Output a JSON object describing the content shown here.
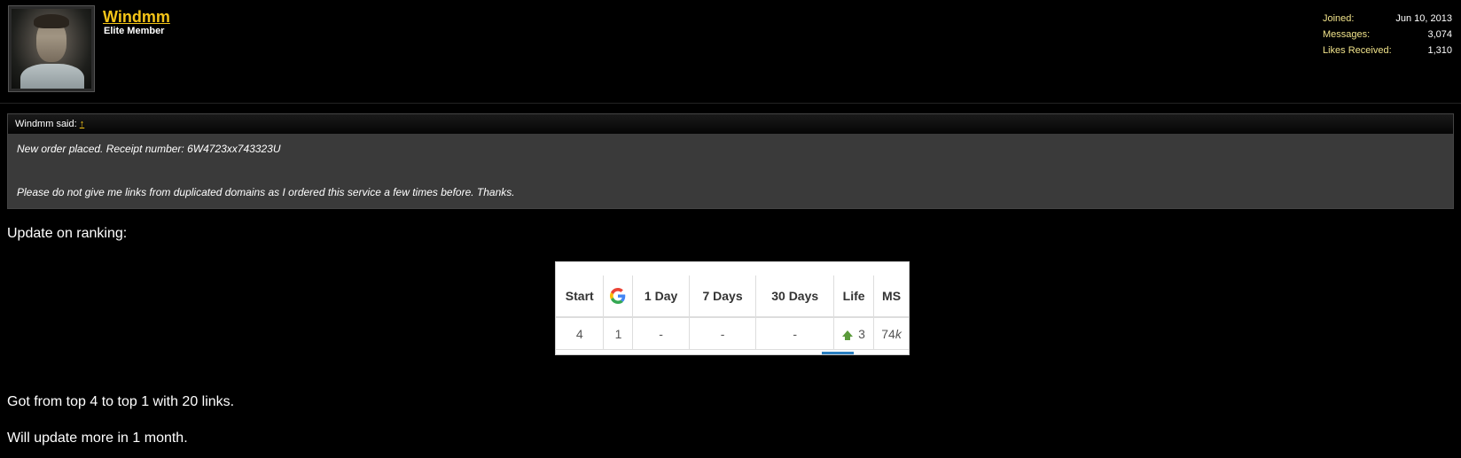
{
  "user": {
    "name": "Windmm",
    "title": "Elite Member"
  },
  "stats": {
    "joined_label": "Joined:",
    "joined_value": "Jun 10, 2013",
    "messages_label": "Messages:",
    "messages_value": "3,074",
    "likes_label": "Likes Received:",
    "likes_value": "1,310"
  },
  "quote": {
    "author": "Windmm said:",
    "arrow": "↑",
    "line1": "New order placed. Receipt number: 6W4723xx743323U",
    "line2": "Please do not give me links from duplicated domains as I ordered this service a few times before. Thanks."
  },
  "post": {
    "intro": "Update on ranking:",
    "line1": "Got from top 4 to top 1 with 20 links.",
    "line2": "Will update more in 1 month."
  },
  "ranking_table": {
    "headers": [
      "Start",
      "",
      "1 Day",
      "7 Days",
      "30 Days",
      "Life",
      "MS"
    ],
    "row": {
      "start": "4",
      "google": "1",
      "day1": "-",
      "day7": "-",
      "day30": "-",
      "life": "3",
      "ms_num": "74",
      "ms_unit": "k"
    }
  },
  "colors": {
    "accent": "#f5c518",
    "quote_bg": "#3a3a3a",
    "up_arrow": "#5a9a3a"
  }
}
